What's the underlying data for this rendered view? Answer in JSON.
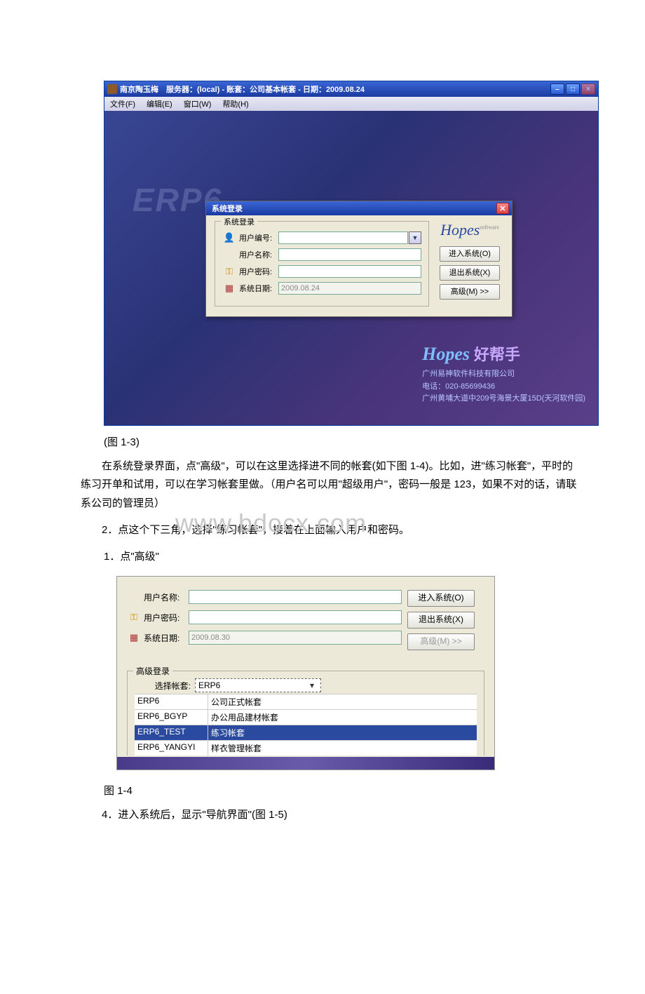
{
  "fig1_3": {
    "titlebar": "南京陶玉梅　服务器：(local) - 账套：公司基本帐套 - 日期：2009.08.24",
    "menus": {
      "file": "文件(F)",
      "edit": "编辑(E)",
      "window": "窗口(W)",
      "help": "帮助(H)"
    },
    "erp_watermark": "ERP6",
    "dialog": {
      "title": "系统登录",
      "legend": "系统登录",
      "user_id_label": "用户编号:",
      "user_name_label": "用户名称:",
      "user_pwd_label": "用户密码:",
      "sys_date_label": "系统日期:",
      "sys_date_value": "2009.08.24",
      "logo": "Hopes",
      "logo_sup": "software",
      "btn_login": "进入系统(O)",
      "btn_exit": "退出系统(X)",
      "btn_adv": "高级(M) >>"
    },
    "brand": {
      "logo": "Hopes",
      "slogan": "好帮手",
      "line1": "广州易神软件科技有限公司",
      "line2": "电话：020-85699436",
      "line3": "广州黄埔大道中209号海景大厦15D(天河软件园)"
    }
  },
  "caption1": "(图 1-3)",
  "watermark": "www.bdocx.com",
  "para1": "在系统登录界面，点\"高级\"，可以在这里选择进不同的帐套(如下图 1-4)。比如，进\"练习帐套\"，平时的练习开单和试用，可以在学习帐套里做。（用户名可以用\"超级用户\"，密码一般是 123，如果不对的话，请联系公司的管理员）",
  "para2": "2．点这个下三角，选择\"练习帐套\"，接着在上面输入用户和密码。",
  "para3": "1．点\"高级\"",
  "fig1_4": {
    "user_name_label": "用户名称:",
    "user_pwd_label": "用户密码:",
    "sys_date_label": "系统日期:",
    "sys_date_value": "2009.08.30",
    "btn_login": "进入系统(O)",
    "btn_exit": "退出系统(X)",
    "btn_adv": "高级(M) >>",
    "adv_legend": "高级登录",
    "select_label": "选择帐套:",
    "select_value": "ERP6",
    "options": [
      {
        "code": "ERP6",
        "name": "公司正式帐套"
      },
      {
        "code": "ERP6_BGYP",
        "name": "办公用品建材帐套"
      },
      {
        "code": "ERP6_TEST",
        "name": "练习帐套"
      },
      {
        "code": "ERP6_YANGYI",
        "name": "样衣管理帐套"
      }
    ],
    "selected_index": 2
  },
  "caption2": "图 1-4",
  "para4": "4．进入系统后，显示\"导航界面\"(图 1-5)"
}
